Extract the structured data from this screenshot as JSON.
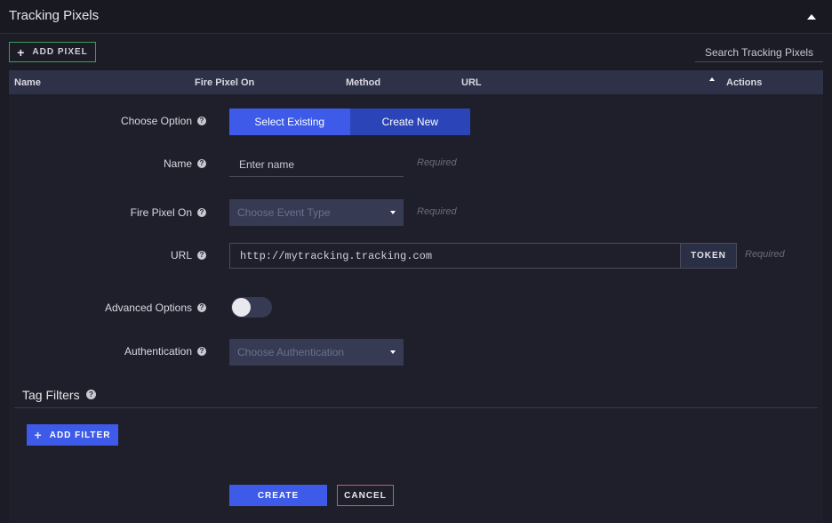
{
  "header": {
    "title": "Tracking Pixels"
  },
  "toolbar": {
    "add_pixel_label": "ADD PIXEL",
    "search_placeholder": "Search Tracking Pixels"
  },
  "table": {
    "columns": [
      "Name",
      "Fire Pixel On",
      "Method",
      "URL",
      "Actions"
    ]
  },
  "form": {
    "choose_option": {
      "label": "Choose Option",
      "options": [
        "Select Existing",
        "Create New"
      ],
      "selected": "Select Existing"
    },
    "name": {
      "label": "Name",
      "placeholder": "Enter name",
      "hint": "Required"
    },
    "fire_pixel_on": {
      "label": "Fire Pixel On",
      "placeholder": "Choose Event Type",
      "hint": "Required"
    },
    "url": {
      "label": "URL",
      "value": "http://mytracking.tracking.com",
      "token_label": "TOKEN",
      "hint": "Required"
    },
    "advanced_options": {
      "label": "Advanced Options",
      "enabled": false
    },
    "authentication": {
      "label": "Authentication",
      "placeholder": "Choose Authentication"
    }
  },
  "tag_filters": {
    "title": "Tag Filters",
    "add_filter_label": "ADD FILTER"
  },
  "actions": {
    "create_label": "CREATE",
    "cancel_label": "CANCEL"
  },
  "colors": {
    "accent": "#3d5ae8",
    "success_border": "#3e9b5a",
    "danger_border": "#d05a6a",
    "table_header": "#2e3248"
  }
}
